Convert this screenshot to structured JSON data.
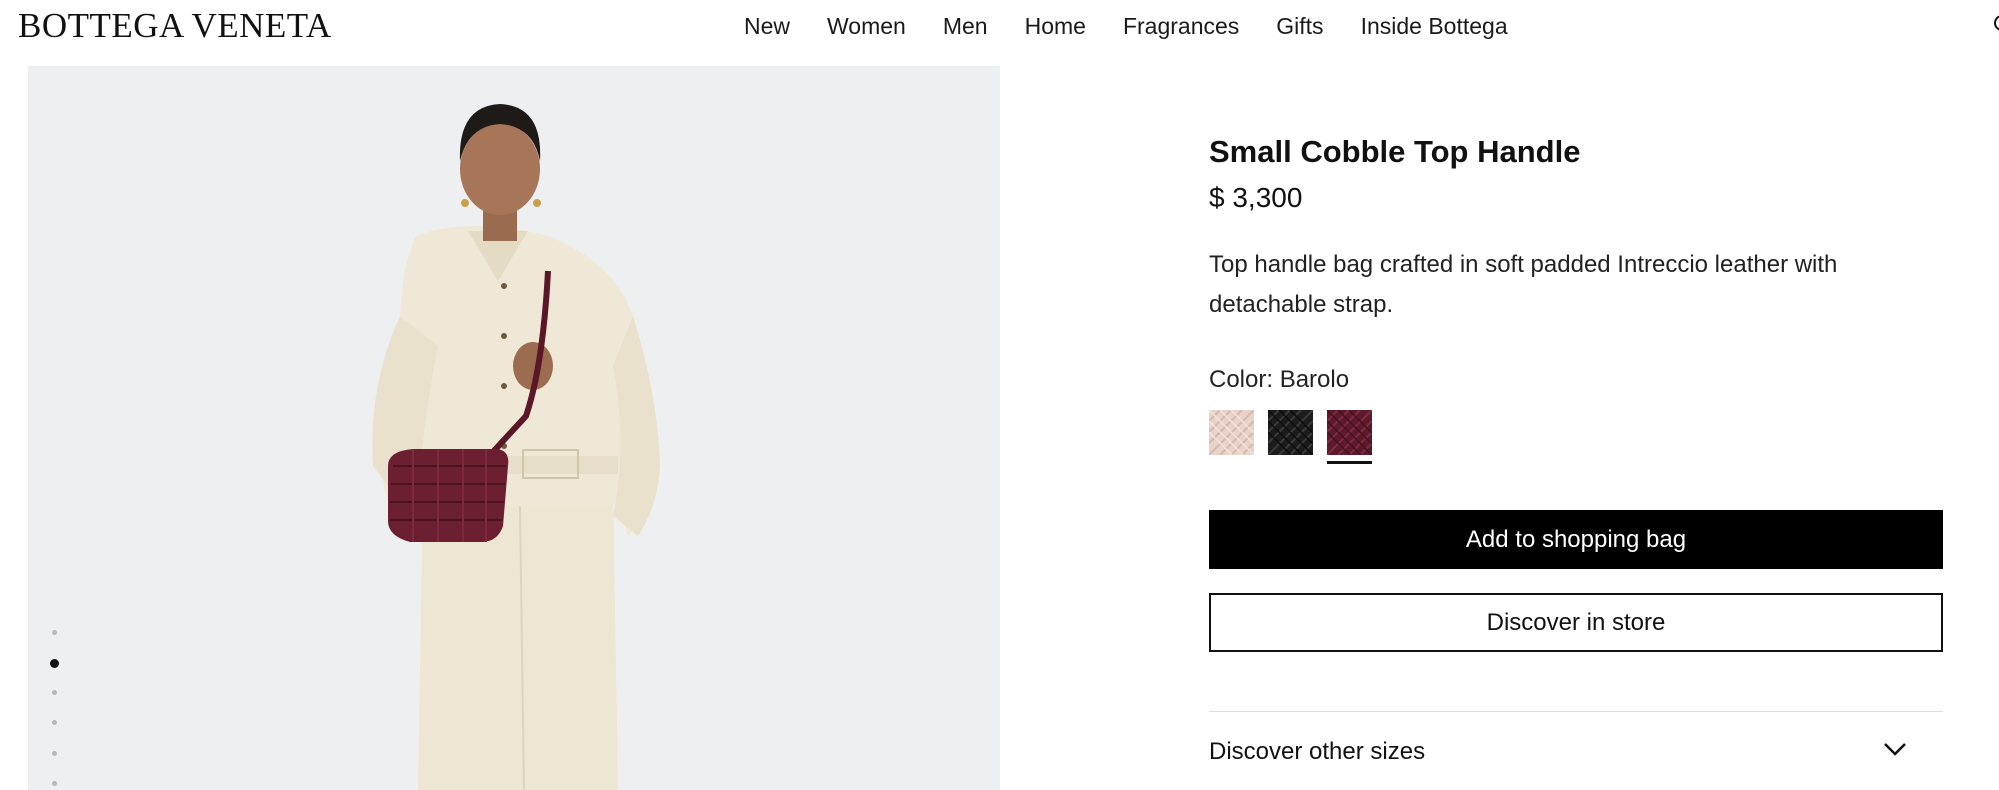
{
  "brand": {
    "logo_text": "BOTTEGA VENETA"
  },
  "nav": {
    "items": [
      "New",
      "Women",
      "Men",
      "Home",
      "Fragrances",
      "Gifts",
      "Inside Bottega"
    ]
  },
  "icons": {
    "search": "search-icon",
    "chevron": "chevron-down-icon"
  },
  "gallery": {
    "image": "model-with-bag-image",
    "dots_count": 6,
    "active_dot_index": 1
  },
  "product": {
    "title": "Small Cobble Top Handle",
    "price": "$ 3,300",
    "description": "Top handle bag crafted in soft padded Intreccio leather with detachable strap.",
    "color_label": "Color:",
    "color_value": "Barolo",
    "swatches": [
      {
        "name": "light-pink",
        "color": "#e8d2c9"
      },
      {
        "name": "black",
        "color": "#1c1c1c"
      },
      {
        "name": "barolo",
        "color": "#5d1a2c"
      }
    ],
    "selected_swatch_index": 2
  },
  "actions": {
    "add_to_bag": "Add to shopping bag",
    "discover_store": "Discover in store"
  },
  "accordion": {
    "label": "Discover other sizes"
  },
  "colors": {
    "primary_button": "#000000",
    "background": "#ffffff",
    "gallery_bg": "#eeeff0"
  }
}
